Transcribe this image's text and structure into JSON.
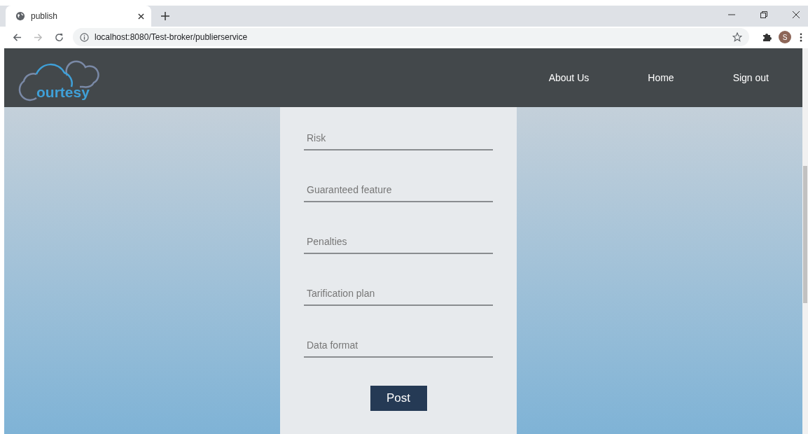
{
  "browser": {
    "tab_title": "publish",
    "url": "localhost:8080/Test-broker/publierservice",
    "profile_initial": "S"
  },
  "header": {
    "logo_text": "ourtesy",
    "nav": [
      "About Us",
      "Home",
      "Sign out"
    ]
  },
  "form": {
    "fields": [
      {
        "placeholder": "Risk"
      },
      {
        "placeholder": "Guaranteed feature"
      },
      {
        "placeholder": "Penalties"
      },
      {
        "placeholder": "Tarification plan"
      },
      {
        "placeholder": "Data format"
      }
    ],
    "submit": "Post"
  }
}
